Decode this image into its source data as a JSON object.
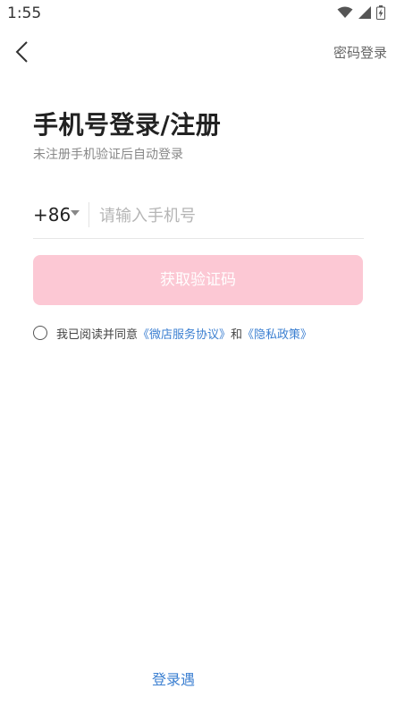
{
  "status_bar": {
    "time": "1:55",
    "icons": [
      "wifi-icon",
      "signal-icon",
      "battery-charging-icon"
    ]
  },
  "nav": {
    "back_icon": "chevron-left-icon",
    "right_label": "密码登录"
  },
  "header": {
    "title": "手机号登录/注册",
    "subtitle": "未注册手机验证后自动登录"
  },
  "phone": {
    "country_code": "+86",
    "placeholder": "请输入手机号",
    "value": ""
  },
  "primary_button": {
    "label": "获取验证码",
    "color": "#fcc8d4"
  },
  "agreement": {
    "prefix": "我已阅读并同意",
    "service_link": "《微店服务协议》",
    "and": "和",
    "privacy_link": "《隐私政策》",
    "link_color": "#3b7fd1",
    "checked": false
  },
  "footer": {
    "link_text": "登录遇"
  }
}
